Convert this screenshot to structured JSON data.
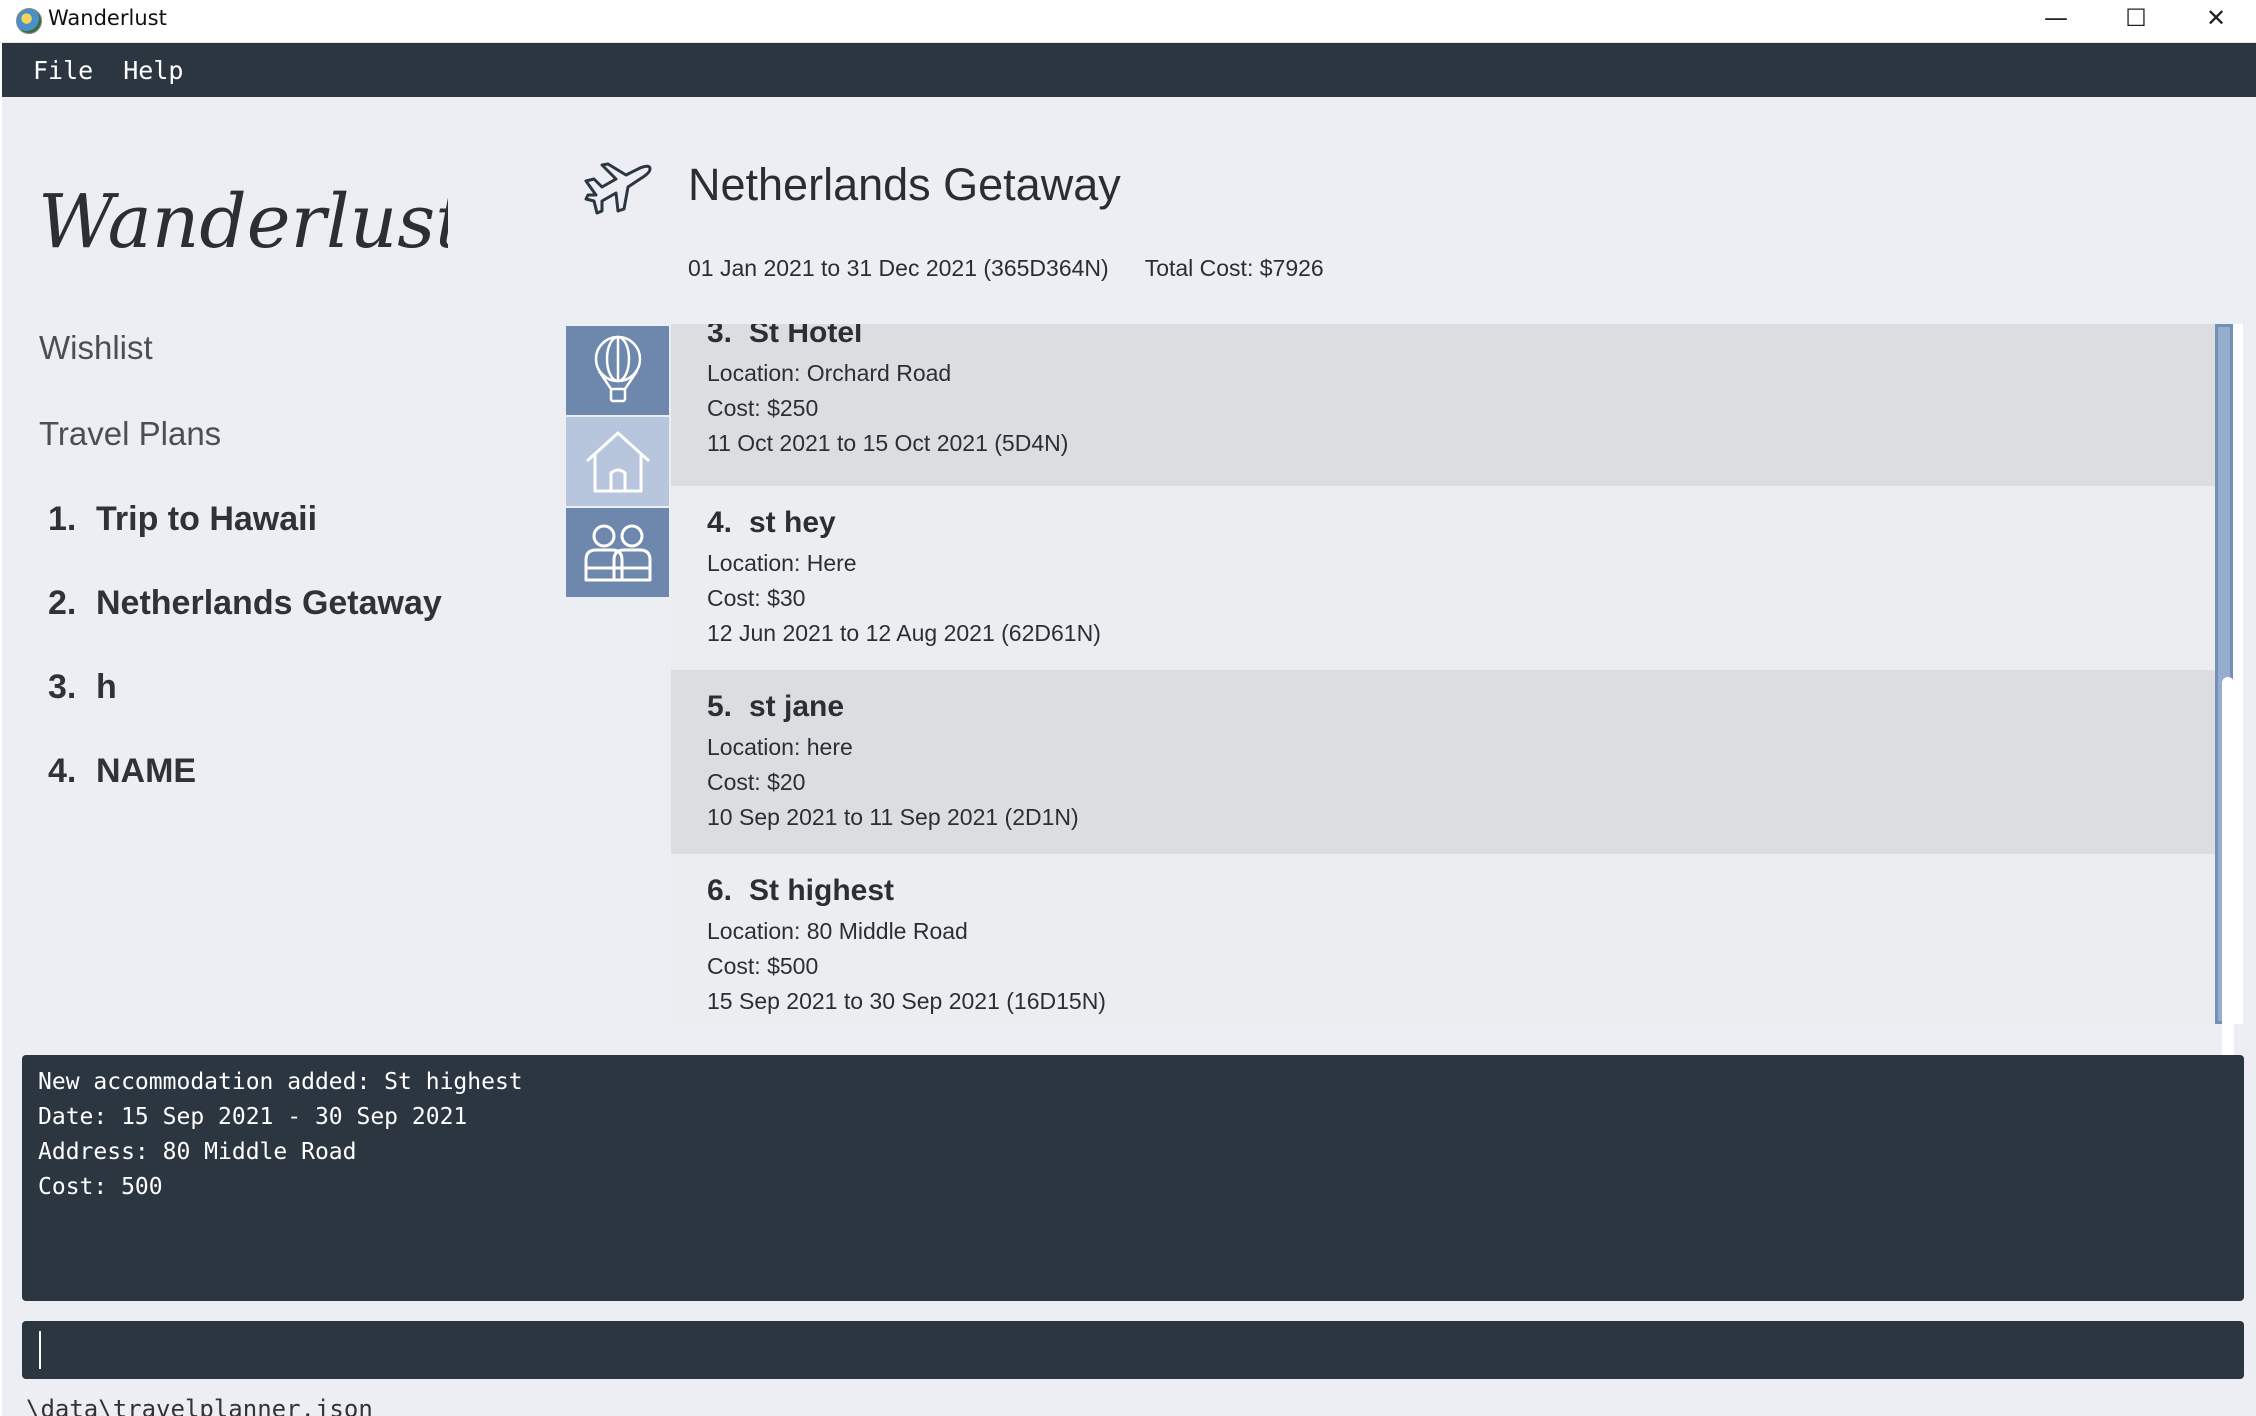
{
  "window": {
    "title": "Wanderlust",
    "minimize": "—",
    "maximize": "☐",
    "close": "✕"
  },
  "menu": [
    "File",
    "Help"
  ],
  "sidebar": {
    "logo_text": "Wanderlust",
    "wishlist": "Wishlist",
    "travel_plans": "Travel Plans",
    "plans": [
      {
        "num": "1.",
        "name": "Trip to Hawaii"
      },
      {
        "num": "2.",
        "name": "Netherlands Getaway"
      },
      {
        "num": "3.",
        "name": "h"
      },
      {
        "num": "4.",
        "name": "NAME"
      }
    ]
  },
  "header": {
    "title": "Netherlands Getaway",
    "dates": "01 Jan 2021 to 31 Dec 2021 (365D364N)",
    "total_cost": "Total Cost: $7926"
  },
  "tabs": [
    {
      "icon": "hot-air-balloon-icon"
    },
    {
      "icon": "house-icon"
    },
    {
      "icon": "people-icon"
    }
  ],
  "accommodations": [
    {
      "num": "3.",
      "name": "St Hotel",
      "location": "Location: Orchard Road",
      "cost": "Cost: $250",
      "dates": "11 Oct 2021 to 15 Oct 2021 (5D4N)"
    },
    {
      "num": "4.",
      "name": "st hey",
      "location": "Location: Here",
      "cost": "Cost: $30",
      "dates": "12 Jun 2021 to 12 Aug 2021 (62D61N)"
    },
    {
      "num": "5.",
      "name": "st jane",
      "location": "Location: here",
      "cost": "Cost: $20",
      "dates": "10 Sep 2021 to 11 Sep 2021 (2D1N)"
    },
    {
      "num": "6.",
      "name": "St highest",
      "location": "Location: 80 Middle Road",
      "cost": "Cost: $500",
      "dates": "15 Sep 2021 to 30 Sep 2021 (16D15N)"
    }
  ],
  "result": {
    "line1": "New accommodation added: St highest",
    "line2": "Date: 15 Sep 2021 - 30 Sep 2021",
    "line3": "Address: 80 Middle Road",
    "line4": "Cost: 500"
  },
  "command": {
    "value": ""
  },
  "status": {
    "path": "\\data\\travelplanner.json"
  }
}
